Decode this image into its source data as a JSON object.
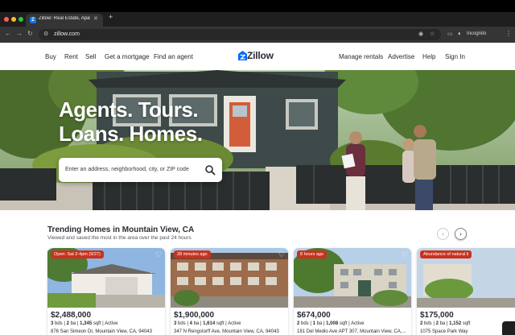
{
  "browser": {
    "tab_title": "Zillow: Real Estate, Apartments",
    "url": "zillow.com",
    "incognito_label": "Incognito",
    "tab_icon": "Z"
  },
  "header": {
    "nav_left": [
      "Buy",
      "Rent",
      "Sell",
      "Get a mortgage",
      "Find an agent"
    ],
    "logo": "Zillow",
    "nav_right": [
      "Manage rentals",
      "Advertise",
      "Help",
      "Sign In"
    ]
  },
  "hero": {
    "title_line1": "Agents. Tours.",
    "title_line2": "Loans. Homes.",
    "search_placeholder": "Enter an address, neighborhood, city, or ZIP code"
  },
  "trending": {
    "title": "Trending Homes in Mountain View, CA",
    "subtitle": "Viewed and saved the most in the area over the past 24 hours",
    "cards": [
      {
        "badge": "Open: Sat 2-4pm (9/27)",
        "price": "$2,488,000",
        "bds": "3",
        "ba": "2",
        "sqft": "1,345",
        "status": "Active",
        "address": "876 San Simeon Dr, Mountain View, CA, 94043"
      },
      {
        "badge": "28 minutes ago",
        "price": "$1,900,000",
        "bds": "3",
        "ba": "4",
        "sqft": "1,614",
        "status": "Active",
        "address": "347 N Rengstorff Ave, Mountain View, CA, 94043"
      },
      {
        "badge": "8 hours ago",
        "price": "$674,000",
        "bds": "2",
        "ba": "1",
        "sqft": "1,008",
        "status": "Active",
        "address": "181 Del Medio Ave APT 307, Mountain View, CA,..."
      },
      {
        "badge": "Abundance of natural li",
        "price": "$175,000",
        "bds": "2",
        "ba": "2",
        "sqft": "1,152",
        "status": "",
        "address": "1075 Space Park Way"
      }
    ]
  },
  "colors": {
    "brand": "#006aff",
    "badge": "#c9321e",
    "text": "#2a2a33"
  }
}
